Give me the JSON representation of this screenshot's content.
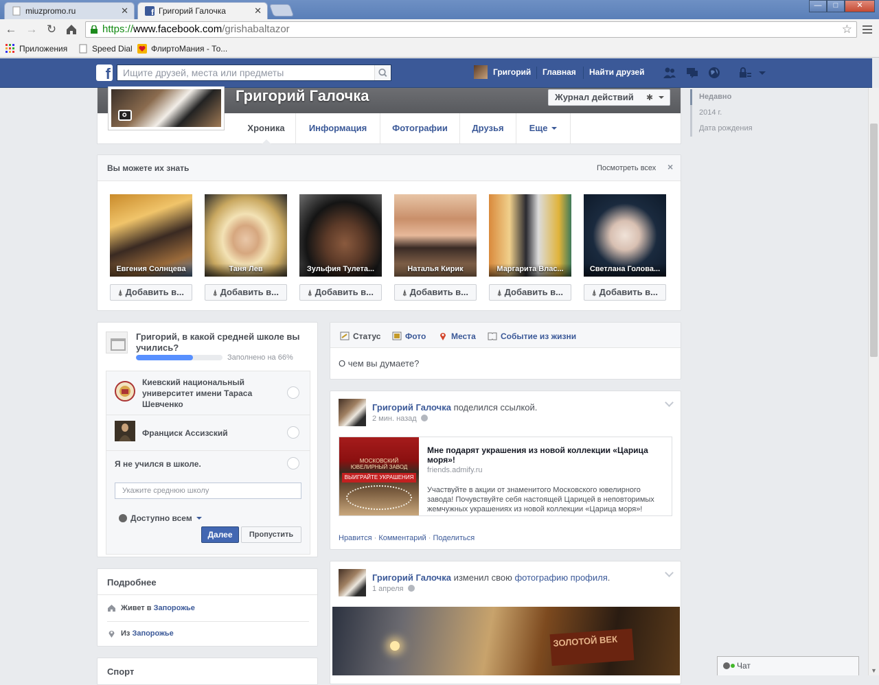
{
  "browser": {
    "tabs": [
      {
        "title": "miuzpromo.ru",
        "active": false
      },
      {
        "title": "Григорий Галочка",
        "active": true
      }
    ],
    "url": {
      "scheme": "https://",
      "host": "www.facebook.com",
      "path": "/grishabaltazor"
    },
    "bookmarks": [
      "Приложения",
      "Speed Dial",
      "ФлиртоМания - То..."
    ],
    "window_buttons": {
      "minimize": "—",
      "maximize": "□",
      "close": "✕"
    }
  },
  "bluebar": {
    "search_placeholder": "Ищите друзей, места или предметы",
    "user": "Григорий",
    "home": "Главная",
    "find_friends": "Найти друзей"
  },
  "profile": {
    "name": "Григорий Галочка",
    "activity_log": "Журнал действий",
    "tabs": [
      "Хроника",
      "Информация",
      "Фотографии",
      "Друзья",
      "Еще"
    ],
    "active_tab": "Хроника"
  },
  "timeline_nav": [
    "Недавно",
    "2014 г.",
    "Дата рождения"
  ],
  "pymk": {
    "title": "Вы можете их знать",
    "see_all": "Посмотреть всех",
    "close": "×",
    "add_label": "Добавить в...",
    "people": [
      {
        "name": "Евгения Солнцева"
      },
      {
        "name": "Таня Лев"
      },
      {
        "name": "Зульфия Тулета..."
      },
      {
        "name": "Наталья Кирик"
      },
      {
        "name": "Маргарита Влас..."
      },
      {
        "name": "Светлана Голова..."
      }
    ]
  },
  "school_question": {
    "question": "Григорий, в какой средней школе вы учились?",
    "progress_percent": 66,
    "progress_text": "Заполнено на 66%",
    "options": [
      "Киевский национальный университет имени Тараса Шевченко",
      "Франциск Ассизский",
      "Я не учился в школе."
    ],
    "input_placeholder": "Укажите среднюю школу",
    "privacy": "Доступно всем",
    "next": "Далее",
    "skip": "Пропустить"
  },
  "about": {
    "title": "Подробнее",
    "lives_prefix": "Живет в",
    "lives_city": "Запорожье",
    "from_prefix": "Из",
    "from_city": "Запорожье"
  },
  "sport": {
    "title": "Спорт"
  },
  "composer": {
    "tabs": [
      "Статус",
      "Фото",
      "Места",
      "Событие из жизни"
    ],
    "placeholder": "О чем вы думаете?"
  },
  "story1": {
    "author": "Григорий Галочка",
    "action": "поделился ссылкой.",
    "time": "2 мин. назад",
    "link_title": "Мне подарят украшения из новой коллекции «Царица моря»!",
    "link_domain": "friends.admify.ru",
    "link_desc": "Участвуйте в акции от знаменитого Московского ювелирного завода! Почувствуйте себя настоящей Царицей в неповторимых жемчужных украшениях из новой коллекции «Царица моря»!",
    "img_brand": "МОСКОВСКИЙ ЮВЕЛИРНЫЙ ЗАВОД",
    "img_banner": "ВЫИГРАЙТЕ УКРАШЕНИЯ",
    "like": "Нравится",
    "comment": "Комментарий",
    "share": "Поделиться"
  },
  "story2": {
    "author": "Григорий Галочка",
    "action": "изменил свою",
    "action_link": "фотографию профиля",
    "time": "1 апреля",
    "sign_text": "ЗОЛОТОЙ ВЕК"
  },
  "chat": {
    "label": "Чат"
  }
}
